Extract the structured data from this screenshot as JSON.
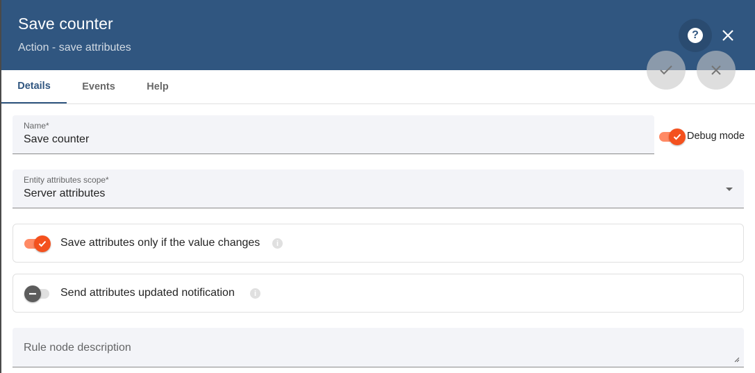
{
  "header": {
    "title": "Save counter",
    "subtitle": "Action - save attributes",
    "help_icon": "help-circle-icon",
    "close_icon": "close-icon",
    "apply_icon": "check-icon",
    "discard_icon": "close-icon"
  },
  "tabs": [
    {
      "label": "Details",
      "active": true
    },
    {
      "label": "Events",
      "active": false
    },
    {
      "label": "Help",
      "active": false
    }
  ],
  "form": {
    "name": {
      "label": "Name*",
      "value": "Save counter"
    },
    "debug_mode": {
      "label": "Debug mode",
      "checked": true
    },
    "scope": {
      "label": "Entity attributes scope*",
      "value": "Server attributes"
    },
    "save_if_changed": {
      "label": "Save attributes only if the value changes",
      "checked": true
    },
    "send_notification": {
      "label": "Send attributes updated notification",
      "checked": false
    },
    "description": {
      "placeholder": "Rule node description",
      "value": ""
    }
  },
  "colors": {
    "header_bg": "#305680",
    "accent_toggle": "#f4511e",
    "field_bg": "#f3f4f8"
  }
}
